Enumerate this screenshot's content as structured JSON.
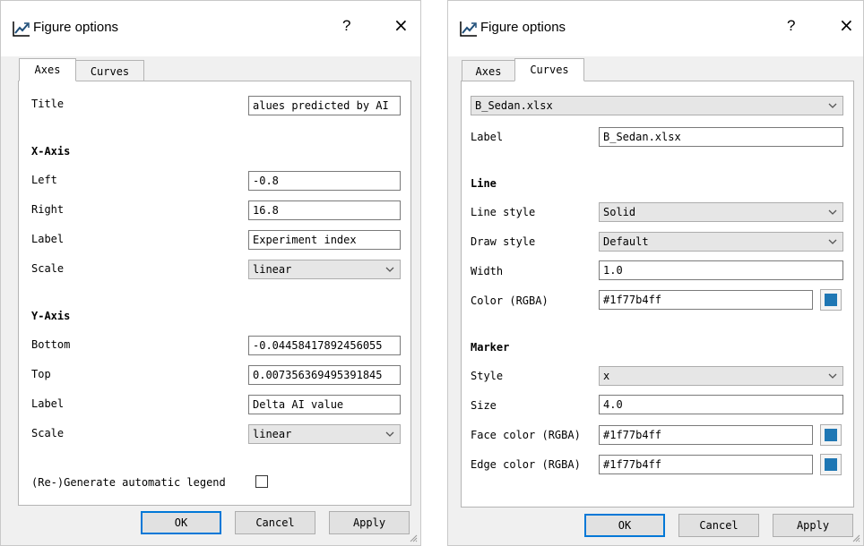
{
  "left_dialog": {
    "title": "Figure options",
    "help": "?",
    "close": "×",
    "tabs": [
      "Axes",
      "Curves"
    ],
    "title_label": "Title",
    "title_value": "alues predicted by AI",
    "x_axis": {
      "heading": "X-Axis",
      "left_label": "Left",
      "left_value": "-0.8",
      "right_label": "Right",
      "right_value": "16.8",
      "label_label": "Label",
      "label_value": "Experiment index",
      "scale_label": "Scale",
      "scale_value": "linear"
    },
    "y_axis": {
      "heading": "Y-Axis",
      "bottom_label": "Bottom",
      "bottom_value": "-0.04458417892456055",
      "top_label": "Top",
      "top_value": "0.007356369495391845",
      "label_label": "Label",
      "label_value": "Delta AI value",
      "scale_label": "Scale",
      "scale_value": "linear"
    },
    "legend_label": "(Re-)Generate automatic legend",
    "legend_checked": false,
    "buttons": {
      "ok": "OK",
      "cancel": "Cancel",
      "apply": "Apply"
    }
  },
  "right_dialog": {
    "title": "Figure options",
    "help": "?",
    "close": "×",
    "tabs": [
      "Axes",
      "Curves"
    ],
    "curve_select": "B_Sedan.xlsx",
    "label_label": "Label",
    "label_value": "B_Sedan.xlsx",
    "line": {
      "heading": "Line",
      "style_label": "Line style",
      "style_value": "Solid",
      "draw_label": "Draw style",
      "draw_value": "Default",
      "width_label": "Width",
      "width_value": "1.0",
      "color_label": "Color (RGBA)",
      "color_value": "#1f77b4ff"
    },
    "marker": {
      "heading": "Marker",
      "style_label": "Style",
      "style_value": "x",
      "size_label": "Size",
      "size_value": "4.0",
      "face_label": "Face color (RGBA)",
      "face_value": "#1f77b4ff",
      "edge_label": "Edge color (RGBA)",
      "edge_value": "#1f77b4ff"
    },
    "buttons": {
      "ok": "OK",
      "cancel": "Cancel",
      "apply": "Apply"
    }
  },
  "colors": {
    "swatch": "#1f77b4",
    "accent": "#0078d7",
    "icon_line": "#1f4e79"
  },
  "icons": {
    "figure": "line-chart-icon",
    "dropdown": "chevron-down-icon",
    "resize": "resize-grip-icon"
  }
}
